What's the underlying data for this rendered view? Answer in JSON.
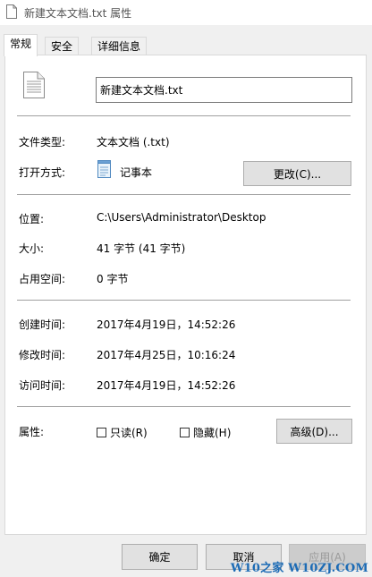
{
  "window": {
    "title": "新建文本文档.txt 属性",
    "title_icon": "file-icon"
  },
  "tabs": [
    {
      "label": "常规",
      "active": true
    },
    {
      "label": "安全",
      "active": false
    },
    {
      "label": "详细信息",
      "active": false
    }
  ],
  "general": {
    "file_icon": "text-file-icon",
    "filename": "新建文本文档.txt",
    "type_label": "文件类型:",
    "type_value": "文本文档 (.txt)",
    "open_with_label": "打开方式:",
    "open_with_icon": "notepad-icon",
    "open_with_value": "记事本",
    "change_button": "更改(C)...",
    "location_label": "位置:",
    "location_value": "C:\\Users\\Administrator\\Desktop",
    "size_label": "大小:",
    "size_value": "41 字节 (41 字节)",
    "size_on_disk_label": "占用空间:",
    "size_on_disk_value": "0 字节",
    "created_label": "创建时间:",
    "created_value": "2017年4月19日，14:52:26",
    "modified_label": "修改时间:",
    "modified_value": "2017年4月25日，10:16:24",
    "accessed_label": "访问时间:",
    "accessed_value": "2017年4月19日，14:52:26",
    "attributes_label": "属性:",
    "readonly_label": "只读(R)",
    "readonly_checked": false,
    "hidden_label": "隐藏(H)",
    "hidden_checked": false,
    "advanced_button": "高级(D)..."
  },
  "footer": {
    "ok_button": "确定",
    "cancel_button": "取消",
    "apply_button": "应用(A)"
  },
  "watermark": {
    "text": "W10之家 W10ZJ.COM",
    "color": "#1c6bb5"
  }
}
